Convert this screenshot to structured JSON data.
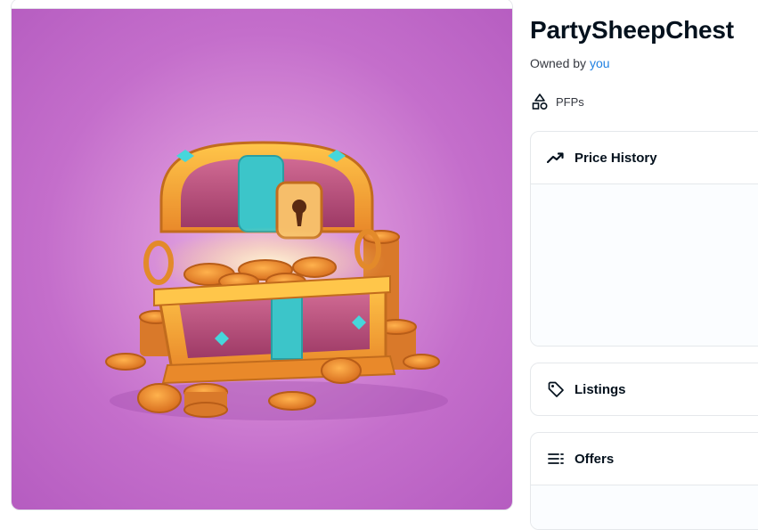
{
  "item": {
    "name": "PartySheepChest",
    "owner_prefix": "Owned by",
    "owner_link": "you"
  },
  "category": {
    "label": "PFPs",
    "icon": "shapes-icon"
  },
  "panels": {
    "price_history": {
      "title": "Price History",
      "icon": "trend-line-icon"
    },
    "listings": {
      "title": "Listings",
      "icon": "tag-icon"
    },
    "offers": {
      "title": "Offers",
      "icon": "list-icon"
    }
  },
  "colors": {
    "link": "#2081e2",
    "artwork_background": "#c46ecb",
    "chest_gold": "#f2a531",
    "chest_cushion": "#b94a78",
    "chest_band": "#3cc5c9",
    "border": "#e5e8eb"
  }
}
